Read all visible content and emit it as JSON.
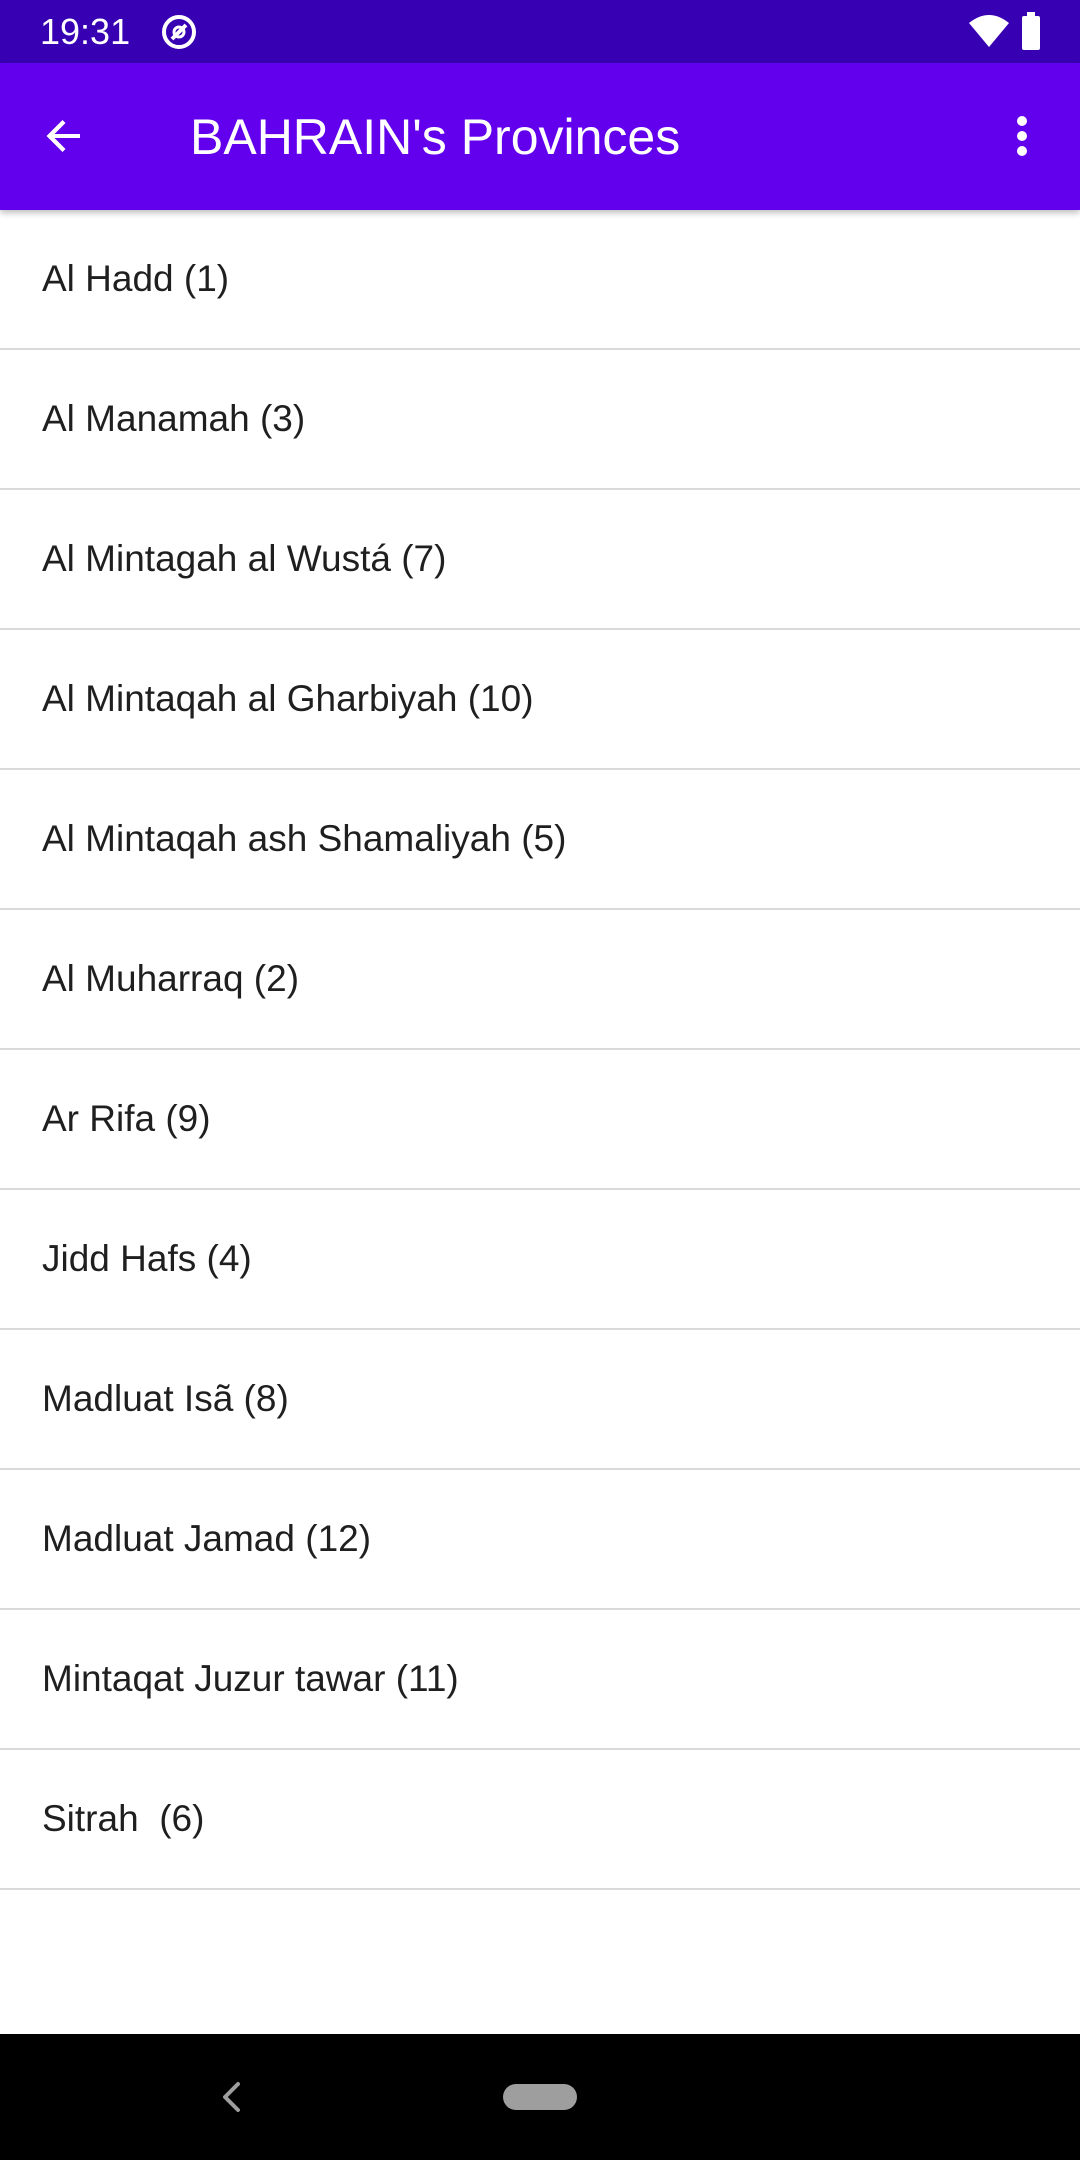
{
  "status_bar": {
    "time": "19:31",
    "icons": [
      "notification-icon",
      "wifi-icon",
      "battery-icon"
    ]
  },
  "app_bar": {
    "title": "BAHRAIN's Provinces",
    "nav_icon": "arrow-back-icon",
    "menu_icon": "more-vert-icon",
    "background_color": "#6200ee",
    "status_bar_color": "#3700b3"
  },
  "provinces": [
    {
      "label": "Al Hadd (1)"
    },
    {
      "label": "Al Manamah (3)"
    },
    {
      "label": "Al Mintagah al Wustá (7)"
    },
    {
      "label": "Al Mintaqah al Gharbiyah (10)"
    },
    {
      "label": "Al Mintaqah ash Shamaliyah (5)"
    },
    {
      "label": "Al Muharraq (2)"
    },
    {
      "label": "Ar Rifa (9)"
    },
    {
      "label": "Jidd Hafs (4)"
    },
    {
      "label": "Madluat Isã (8)"
    },
    {
      "label": "Madluat Jamad (12)"
    },
    {
      "label": "Mintaqat Juzur tawar (11)"
    },
    {
      "label": "Sitrah  (6)"
    }
  ],
  "nav_bar": {
    "icons": [
      "nav-back-icon",
      "home-pill-icon"
    ]
  }
}
